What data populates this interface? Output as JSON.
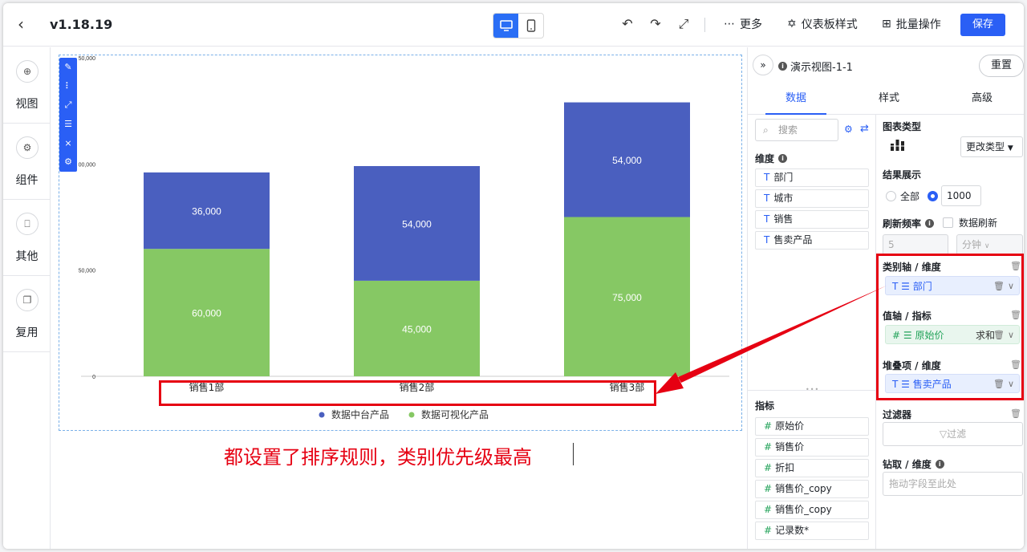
{
  "header": {
    "version": "v1.18.19",
    "more_label": "更多",
    "dashboard_style_label": "仪表板样式",
    "batch_label": "批量操作",
    "save_label": "保存"
  },
  "rail": {
    "items": [
      {
        "label": "视图",
        "icon": "plus-circle-icon"
      },
      {
        "label": "组件",
        "icon": "gear-icon"
      },
      {
        "label": "其他",
        "icon": "plug-icon"
      },
      {
        "label": "复用",
        "icon": "copy-icon"
      }
    ]
  },
  "chart_data": {
    "type": "bar",
    "stacked": true,
    "categories": [
      "销售1部",
      "销售2部",
      "销售3部"
    ],
    "series": [
      {
        "name": "数据可视化产品",
        "color": "#86c864",
        "values": [
          60000,
          45000,
          75000
        ]
      },
      {
        "name": "数据中台产品",
        "color": "#4a5fbf",
        "values": [
          36000,
          54000,
          54000
        ]
      }
    ],
    "y_ticks": [
      "0",
      "50,000",
      "00,000",
      "50,000"
    ],
    "ylim": [
      0,
      150000
    ],
    "legend_position": "bottom",
    "data_labels": [
      [
        "60,000",
        "45,000",
        "75,000"
      ],
      [
        "36,000",
        "54,000",
        "54,000"
      ]
    ]
  },
  "annotation": "都设置了排序规则，类别优先级最高",
  "panel": {
    "view_name": "演示视图-1-1",
    "reset_label": "重置",
    "tabs": [
      "数据",
      "样式",
      "高级"
    ],
    "search_placeholder": "搜索",
    "dimension_title": "维度",
    "dimensions": [
      "部门",
      "城市",
      "销售",
      "售卖产品"
    ],
    "measure_title": "指标",
    "measures": [
      "原始价",
      "销售价",
      "折扣",
      "销售价_copy",
      "销售价_copy",
      "记录数*"
    ],
    "chart_type_title": "图表类型",
    "change_type_label": "更改类型",
    "result_title": "结果展示",
    "all_label": "全部",
    "result_count": "1000",
    "refresh_title": "刷新频率",
    "data_refresh_label": "数据刷新",
    "refresh_value": "5",
    "refresh_unit": "分钟",
    "axis_title": "类别轴 / 维度",
    "axis_field": "部门",
    "value_title": "值轴 / 指标",
    "value_field": "原始价",
    "value_agg": "求和",
    "stack_title": "堆叠项 / 维度",
    "stack_field": "售卖产品",
    "filter_title": "过滤器",
    "filter_label": "过滤",
    "drill_title": "钻取 / 维度",
    "drill_placeholder": "拖动字段至此处"
  },
  "colors": {
    "accent": "#2a5ff5",
    "annotation": "#e60012"
  }
}
